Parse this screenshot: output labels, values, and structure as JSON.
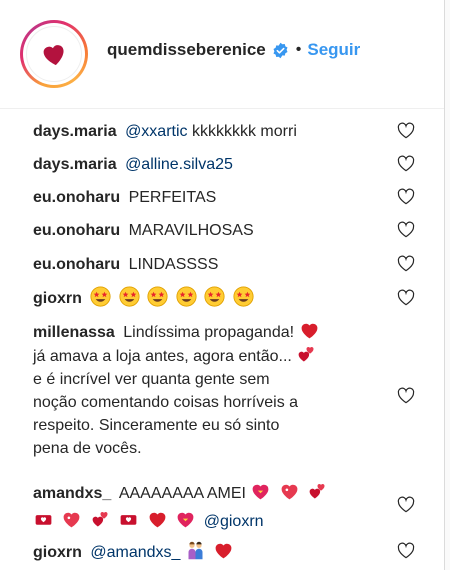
{
  "header": {
    "username": "quemdisseberenice",
    "separator": "•",
    "follow_label": "Seguir"
  },
  "comments": [
    {
      "user": "days.maria",
      "mention": "@xxartic",
      "text": "kkkkkkkk morri"
    },
    {
      "user": "days.maria",
      "mention": "@alline.silva25",
      "text": ""
    },
    {
      "user": "eu.onoharu",
      "text": "PERFEITAS"
    },
    {
      "user": "eu.onoharu",
      "text": "MARAVILHOSAS"
    },
    {
      "user": "eu.onoharu",
      "text": "LINDASSSS"
    },
    {
      "user": "gioxrn",
      "emojis": [
        "star-struck",
        "star-struck",
        "star-struck",
        "star-struck",
        "star-struck",
        "star-struck"
      ]
    },
    {
      "user": "millenassa",
      "lines": [
        "Lindíssima propaganda!",
        "já amava a loja antes, agora então...",
        "e é incrível ver quanta gente sem",
        "noção comentando coisas horríveis a",
        "respeito. Sinceramente eu só sinto",
        "pena de vocês."
      ]
    },
    {
      "user": "amandxs_",
      "text": "AAAAAAAA AMEI",
      "mention": "@gioxrn"
    },
    {
      "user": "gioxrn",
      "mention": "@amandxs_"
    }
  ],
  "icons": {
    "like": "heart-outline-icon",
    "verified": "verified-badge-icon"
  },
  "colors": {
    "link": "#3897f0",
    "mention": "#003569",
    "heart_red": "#ed1c24"
  }
}
